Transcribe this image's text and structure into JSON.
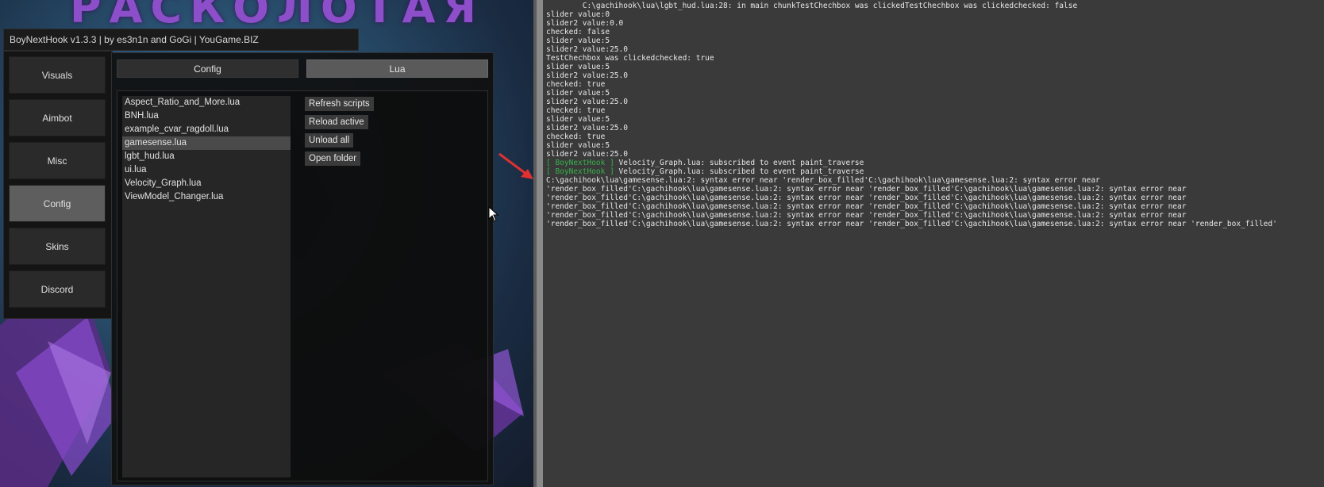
{
  "background": {
    "title_text": "РАСКОЛОТАЯ",
    "accent_color": "#8d4fc9"
  },
  "menu": {
    "title": "BoyNextHook v1.3.3 | by es3n1n and GoGi | YouGame.BIZ",
    "sidebar": {
      "items": [
        {
          "label": "Visuals",
          "active": false
        },
        {
          "label": "Aimbot",
          "active": false
        },
        {
          "label": "Misc",
          "active": false
        },
        {
          "label": "Config",
          "active": true
        },
        {
          "label": "Skins",
          "active": false
        },
        {
          "label": "Discord",
          "active": false
        }
      ]
    },
    "tabs": [
      {
        "label": "Config",
        "active": false
      },
      {
        "label": "Lua",
        "active": true
      }
    ],
    "scripts": [
      {
        "name": "Aspect_Ratio_and_More.lua",
        "selected": false
      },
      {
        "name": "BNH.lua",
        "selected": false
      },
      {
        "name": "example_cvar_ragdoll.lua",
        "selected": false
      },
      {
        "name": "gamesense.lua",
        "selected": true
      },
      {
        "name": "lgbt_hud.lua",
        "selected": false
      },
      {
        "name": "ui.lua",
        "selected": false
      },
      {
        "name": "Velocity_Graph.lua",
        "selected": false
      },
      {
        "name": "ViewModel_Changer.lua",
        "selected": false
      }
    ],
    "actions": {
      "refresh": "Refresh scripts",
      "reload": "Reload active",
      "unload": "Unload all",
      "open_folder": "Open folder"
    }
  },
  "console": {
    "text_color": "#e8e8e8",
    "highlight_color": "#36b24a",
    "lines": [
      {
        "prefix": "",
        "text": "        C:\\gachihook\\lua\\lgbt_hud.lua:28: in main chunkTestChechbox was clickedTestChechbox was clickedchecked: false"
      },
      {
        "prefix": "",
        "text": "slider value:0"
      },
      {
        "prefix": "",
        "text": "slider2 value:0.0"
      },
      {
        "prefix": "",
        "text": "checked: false"
      },
      {
        "prefix": "",
        "text": "slider value:5"
      },
      {
        "prefix": "",
        "text": "slider2 value:25.0"
      },
      {
        "prefix": "",
        "text": "TestChechbox was clickedchecked: true"
      },
      {
        "prefix": "",
        "text": "slider value:5"
      },
      {
        "prefix": "",
        "text": "slider2 value:25.0"
      },
      {
        "prefix": "",
        "text": "checked: true"
      },
      {
        "prefix": "",
        "text": "slider value:5"
      },
      {
        "prefix": "",
        "text": "slider2 value:25.0"
      },
      {
        "prefix": "",
        "text": "checked: true"
      },
      {
        "prefix": "",
        "text": "slider value:5"
      },
      {
        "prefix": "",
        "text": "slider2 value:25.0"
      },
      {
        "prefix": "",
        "text": "checked: true"
      },
      {
        "prefix": "",
        "text": "slider value:5"
      },
      {
        "prefix": "",
        "text": "slider2 value:25.0"
      },
      {
        "prefix": "[ BoyNextHook ] ",
        "text": "Velocity_Graph.lua: subscribed to event paint_traverse"
      },
      {
        "prefix": "[ BoyNextHook ] ",
        "text": "Velocity_Graph.lua: subscribed to event paint_traverse"
      },
      {
        "prefix": "",
        "text": "C:\\gachihook\\lua\\gamesense.lua:2: syntax error near 'render_box_filled'C:\\gachihook\\lua\\gamesense.lua:2: syntax error near"
      },
      {
        "prefix": "",
        "text": "'render_box_filled'C:\\gachihook\\lua\\gamesense.lua:2: syntax error near 'render_box_filled'C:\\gachihook\\lua\\gamesense.lua:2: syntax error near"
      },
      {
        "prefix": "",
        "text": "'render_box_filled'C:\\gachihook\\lua\\gamesense.lua:2: syntax error near 'render_box_filled'C:\\gachihook\\lua\\gamesense.lua:2: syntax error near"
      },
      {
        "prefix": "",
        "text": "'render_box_filled'C:\\gachihook\\lua\\gamesense.lua:2: syntax error near 'render_box_filled'C:\\gachihook\\lua\\gamesense.lua:2: syntax error near"
      },
      {
        "prefix": "",
        "text": "'render_box_filled'C:\\gachihook\\lua\\gamesense.lua:2: syntax error near 'render_box_filled'C:\\gachihook\\lua\\gamesense.lua:2: syntax error near"
      },
      {
        "prefix": "",
        "text": "'render_box_filled'C:\\gachihook\\lua\\gamesense.lua:2: syntax error near 'render_box_filled'C:\\gachihook\\lua\\gamesense.lua:2: syntax error near 'render_box_filled'"
      }
    ]
  }
}
